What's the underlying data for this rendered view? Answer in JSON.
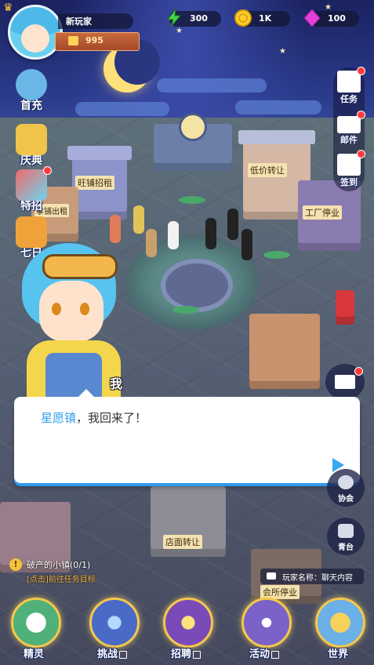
{
  "player": {
    "name": "新玩家",
    "gold": "995"
  },
  "resources": {
    "energy": "300",
    "coins": "1K",
    "gems": "100"
  },
  "left_menu": [
    {
      "label": "首充",
      "icon": "first-recharge-icon"
    },
    {
      "label": "庆典",
      "icon": "celebration-icon"
    },
    {
      "label": "特招",
      "icon": "special-recruit-icon"
    },
    {
      "label": "七日",
      "icon": "seven-day-icon"
    }
  ],
  "right_menu": [
    {
      "label": "任务",
      "icon": "task-book-icon"
    },
    {
      "label": "邮件",
      "icon": "mail-icon"
    },
    {
      "label": "签到",
      "icon": "gift-signin-icon"
    }
  ],
  "signs": {
    "sign1": "旺铺招租",
    "sign2": "低价转让",
    "sign3": "工厂停业",
    "sign4": "店面转让",
    "sign5": "拿铺出租",
    "sign6": "会所停业"
  },
  "dialogue": {
    "speaker": "我",
    "highlight": "星愿镇",
    "text": "，我回来了！"
  },
  "side_buttons": {
    "guild": "协会",
    "stage": "青台"
  },
  "task": {
    "title": "破产的小镇(0/1)",
    "hint": "[点击]前往任务目标"
  },
  "chat": {
    "text": "玩家名称：聊天内容"
  },
  "bottom_nav": [
    {
      "label": "精灵",
      "locked": false
    },
    {
      "label": "挑战",
      "locked": true
    },
    {
      "label": "招聘",
      "locked": true
    },
    {
      "label": "活动",
      "locked": true
    },
    {
      "label": "世界",
      "locked": false
    }
  ],
  "colors": {
    "accent": "#37a0ea",
    "gold": "#f4c84c",
    "task_hint": "#f4b63c"
  }
}
